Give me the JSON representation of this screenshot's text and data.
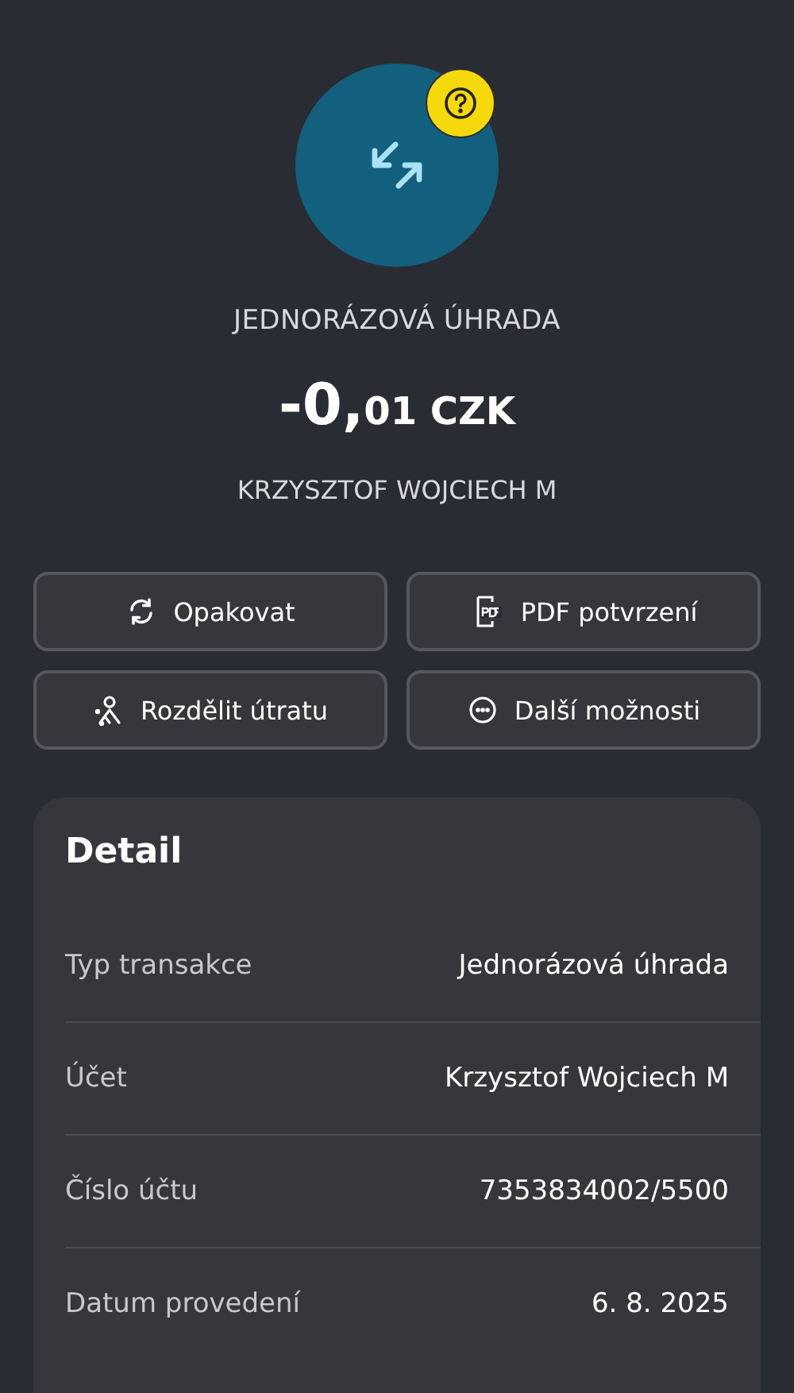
{
  "header": {
    "type_label": "JEDNORÁZOVÁ ÚHRADA",
    "amount_main": "-0,",
    "amount_minor": "01 CZK",
    "counterparty": "KRZYSZTOF WOJCIECH M"
  },
  "actions": [
    {
      "label": "Opakovat",
      "kind": "repeat"
    },
    {
      "label": "PDF potvrzení",
      "kind": "pdf"
    },
    {
      "label": "Rozdělit útratu",
      "kind": "split"
    },
    {
      "label": "Další možnosti",
      "kind": "more"
    }
  ],
  "detail": {
    "title": "Detail",
    "rows": [
      {
        "label": "Typ transakce",
        "value": "Jednorázová úhrada"
      },
      {
        "label": "Účet",
        "value": "Krzysztof Wojciech M"
      },
      {
        "label": "Číslo účtu",
        "value": "7353834002/5500"
      },
      {
        "label": "Datum provedení",
        "value": "6. 8. 2025"
      }
    ]
  }
}
